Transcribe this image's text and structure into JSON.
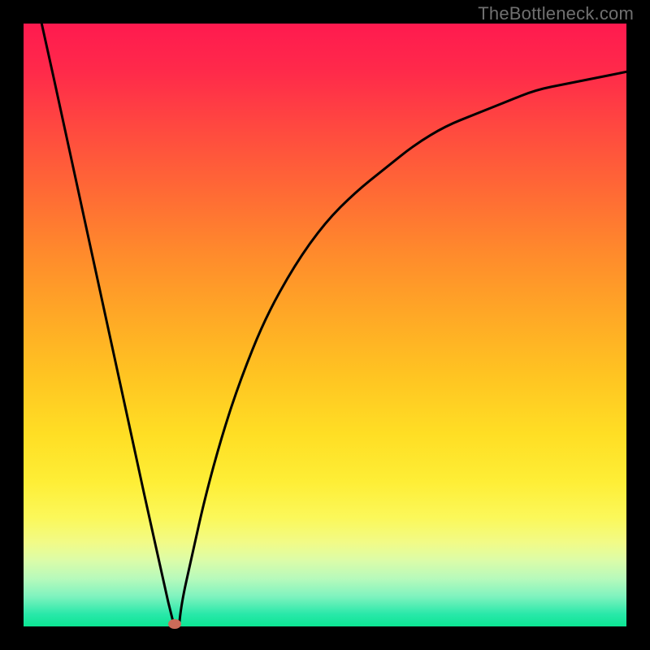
{
  "attribution": "TheBottleneck.com",
  "colors": {
    "frame": "#000000",
    "curve": "#000000",
    "marker": "#cc6b59",
    "gradient_top": "#ff1a4f",
    "gradient_bottom": "#0be593"
  },
  "chart_data": {
    "type": "line",
    "title": "",
    "xlabel": "",
    "ylabel": "",
    "xlim": [
      0,
      100
    ],
    "ylim": [
      0,
      100
    ],
    "grid": false,
    "series": [
      {
        "name": "bottleneck-curve",
        "x": [
          3,
          5,
          10,
          15,
          20,
          22,
          24,
          25,
          26,
          28,
          30,
          33,
          36,
          40,
          45,
          50,
          55,
          60,
          65,
          70,
          75,
          80,
          85,
          90,
          95,
          100
        ],
        "values": [
          100,
          91,
          68,
          45,
          22,
          13,
          4,
          0,
          3,
          12,
          21,
          32,
          41,
          51,
          60,
          67,
          72,
          76,
          80,
          83,
          85,
          87,
          89,
          90,
          91,
          92
        ]
      }
    ],
    "annotations": [
      {
        "name": "minimum-marker",
        "x": 25,
        "y": 0
      }
    ],
    "notes": "V-shaped curve descending linearly from top-left to a minimum near x≈25, then rising along a concave saturating curve toward the upper right. Background is a vertical rainbow heat gradient (red→green). Axis ticks and numeric labels are not shown."
  }
}
